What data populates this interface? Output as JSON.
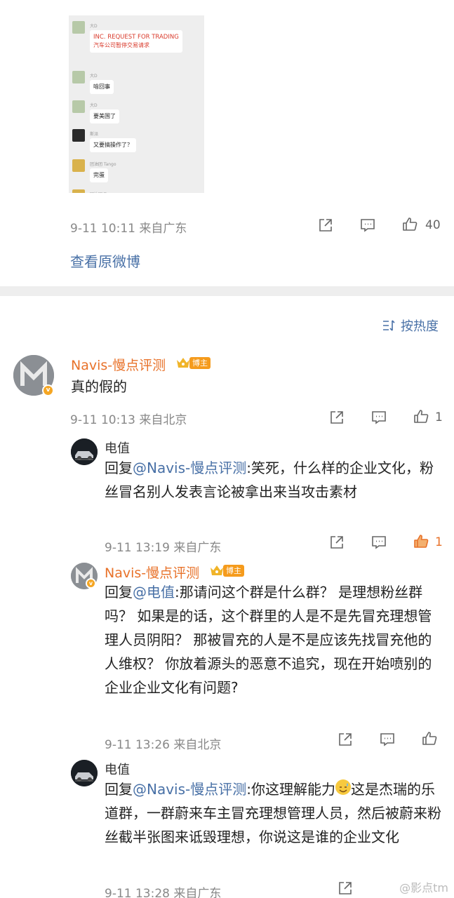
{
  "post": {
    "chat": {
      "rows": [
        {
          "name": "大D",
          "bubble_lines": [
            "INC. REQUEST FOR TRADING",
            "汽车公司暂停交易请求"
          ],
          "red": true
        },
        {
          "name": "大D",
          "bubble_lines": [
            "啥回事"
          ],
          "red": false
        },
        {
          "name": "大D",
          "bubble_lines": [
            "要美国了"
          ],
          "red": false
        },
        {
          "name": "斯派",
          "bubble_lines": [
            "又要搞操作了？"
          ],
          "red": false
        },
        {
          "name": "团油团 Tango",
          "bubble_lines": [
            "完蛋"
          ],
          "red": false
        },
        {
          "name": "团油团 Tango",
          "bubble_lines": [],
          "red": false
        }
      ]
    },
    "time": "9-11 10:11",
    "source": "来自广东",
    "like_count": "40",
    "view_original": "查看原微博"
  },
  "sort_label": "按热度",
  "comments": [
    {
      "name": "Navis-慢点评测",
      "badge": "博主",
      "text": "真的假的",
      "time": "9-11 10:13",
      "source": "来自北京",
      "like_count": "1"
    },
    {
      "name": "电值",
      "reply_prefix": "回复",
      "mention": "@Navis-慢点评测",
      "text": ":笑死，什么样的企业文化，粉丝冒名别人发表言论被拿出来当攻击素材",
      "time": "9-11 13:19",
      "source": "来自广东",
      "like_count": "1"
    },
    {
      "name": "Navis-慢点评测",
      "badge": "博主",
      "reply_prefix": "回复",
      "mention": "@电值",
      "text": ":那请问这个群是什么群？ 是理想粉丝群吗？ 如果是的话，这个群里的人是不是先冒充理想管理人员阴阳？ 那被冒充的人是不是应该先找冒充他的人维权？ 你放着源头的恶意不追究，现在开始喷别的企业企业文化有问题?",
      "time": "9-11 13:26",
      "source": "来自北京"
    },
    {
      "name": "电值",
      "reply_prefix": "回复",
      "mention": "@Navis-慢点评测",
      "text_a": ":你这理解能力",
      "text_b": "这是杰瑞的乐道群，一群蔚来车主冒充理想管理人员，然后被蔚来粉丝截半张图来诋毁理想，你说这是谁的企业文化",
      "time": "9-11 13:28",
      "source": "来自广东"
    }
  ],
  "watermark": "@影点tm",
  "colors": {
    "link": "#4870a6",
    "name": "#e8722a",
    "liked": "#e8722a",
    "divider": "#eeeeee"
  }
}
